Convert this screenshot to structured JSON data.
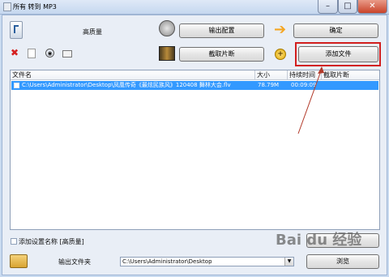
{
  "window": {
    "title": "所有 转到 MP3"
  },
  "toolbar": {
    "quality_label": "高质量",
    "output_config_label": "输出配置",
    "confirm_label": "确定",
    "clip_label": "截取片断",
    "add_file_label": "添加文件"
  },
  "file_list": {
    "columns": [
      "文件名",
      "大小",
      "持续时间",
      "截取片断"
    ],
    "rows": [
      {
        "name": "C:\\Users\\Administrator\\Desktop\\凤凰传奇《最炫民族风》120408 舞林大会.flv",
        "size": "78.79M",
        "duration": "00:09:09",
        "clip": ""
      }
    ]
  },
  "bottom": {
    "add_setting_name_label": "添加设置名称 [高质量]",
    "output_folder_label": "输出文件夹",
    "output_folder_value": "C:\\Users\\Administrator\\Desktop",
    "browse_label": "浏览"
  },
  "watermark": {
    "text": "Bai du 经验"
  },
  "colors": {
    "selection": "#3399ff",
    "highlight_box": "#d21e1e"
  }
}
